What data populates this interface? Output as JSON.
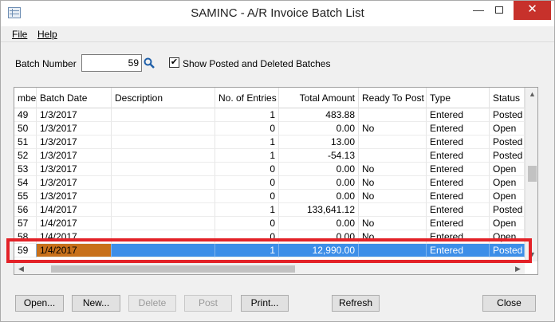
{
  "window": {
    "title": "SAMINC - A/R Invoice Batch List"
  },
  "menu": {
    "file": "File",
    "help": "Help"
  },
  "batch": {
    "label": "Batch Number",
    "value": "59"
  },
  "show_posted": {
    "label": "Show Posted and Deleted Batches",
    "checked": true,
    "mark": "✔"
  },
  "grid": {
    "columns": [
      "mber",
      "Batch Date",
      "Description",
      "No. of Entries",
      "Total Amount",
      "Ready To Post",
      "Type",
      "Status"
    ],
    "rows": [
      [
        "49",
        "1/3/2017",
        "",
        "1",
        "483.88",
        "",
        "Entered",
        "Posted"
      ],
      [
        "50",
        "1/3/2017",
        "",
        "0",
        "0.00",
        "No",
        "Entered",
        "Open"
      ],
      [
        "51",
        "1/3/2017",
        "",
        "1",
        "13.00",
        "",
        "Entered",
        "Posted"
      ],
      [
        "52",
        "1/3/2017",
        "",
        "1",
        "-54.13",
        "",
        "Entered",
        "Posted"
      ],
      [
        "53",
        "1/3/2017",
        "",
        "0",
        "0.00",
        "No",
        "Entered",
        "Open"
      ],
      [
        "54",
        "1/3/2017",
        "",
        "0",
        "0.00",
        "No",
        "Entered",
        "Open"
      ],
      [
        "55",
        "1/3/2017",
        "",
        "0",
        "0.00",
        "No",
        "Entered",
        "Open"
      ],
      [
        "56",
        "1/4/2017",
        "",
        "1",
        "133,641.12",
        "",
        "Entered",
        "Posted"
      ],
      [
        "57",
        "1/4/2017",
        "",
        "0",
        "0.00",
        "No",
        "Entered",
        "Open"
      ],
      [
        "58",
        "1/4/2017",
        "",
        "0",
        "0.00",
        "No",
        "Entered",
        "Open"
      ],
      [
        "59",
        "1/4/2017",
        "",
        "1",
        "12,990.00",
        "",
        "Entered",
        "Posted"
      ]
    ],
    "selected_batch": "59"
  },
  "buttons": {
    "open": "Open...",
    "new": "New...",
    "delete": "Delete",
    "post": "Post",
    "print": "Print...",
    "refresh": "Refresh",
    "close": "Close"
  },
  "icons": {
    "app": "grid-app-icon",
    "finder": "search-icon",
    "minimize": "minimize-icon",
    "maximize": "maximize-icon",
    "close": "close-icon"
  },
  "colors": {
    "selection": "#3d8ee8",
    "current_cell": "#c8701a",
    "highlight": "#e32228",
    "close_button": "#c7312b"
  }
}
